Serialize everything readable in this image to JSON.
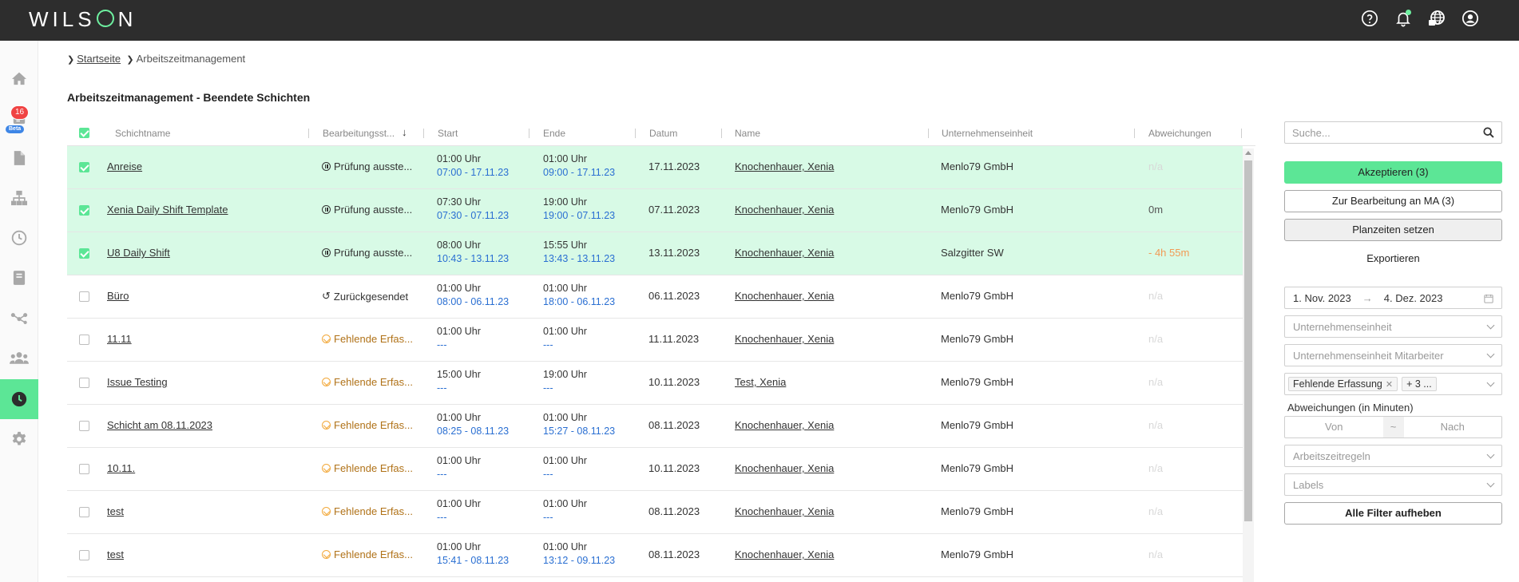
{
  "app": {
    "logo": "WILSON",
    "nav_badge": "16",
    "beta_label": "Beta"
  },
  "breadcrumb": {
    "home": "Startseite",
    "current": "Arbeitszeitmanagement"
  },
  "page_title": "Arbeitszeitmanagement - Beendete Schichten",
  "table": {
    "columns": [
      "Schichtname",
      "Bearbeitungsst...",
      "Start",
      "Ende",
      "Datum",
      "Name",
      "Unternehmenseinheit",
      "Abweichungen"
    ],
    "rows": [
      {
        "shift": "Anreise",
        "status": "Prüfung ausste...",
        "status_type": "pause",
        "start_plan": "01:00 Uhr",
        "start_actual": "07:00 - 17.11.23",
        "end_plan": "01:00 Uhr",
        "end_actual": "09:00 - 17.11.23",
        "date": "17.11.2023",
        "name": "Knochenhauer, Xenia",
        "unit": "Menlo79 GmbH",
        "deviation": "n/a",
        "deviation_type": "na",
        "selected": true
      },
      {
        "shift": "Xenia Daily Shift Template",
        "status": "Prüfung ausste...",
        "status_type": "pause",
        "start_plan": "07:30 Uhr",
        "start_actual": "07:30 - 07.11.23",
        "end_plan": "19:00 Uhr",
        "end_actual": "19:00 - 07.11.23",
        "date": "07.11.2023",
        "name": "Knochenhauer, Xenia",
        "unit": "Menlo79 GmbH",
        "deviation": "0m",
        "deviation_type": "pos",
        "selected": true
      },
      {
        "shift": "U8 Daily Shift",
        "status": "Prüfung ausste...",
        "status_type": "pause",
        "start_plan": "08:00 Uhr",
        "start_actual": "10:43 - 13.11.23",
        "end_plan": "15:55 Uhr",
        "end_actual": "13:43 - 13.11.23",
        "date": "13.11.2023",
        "name": "Knochenhauer, Xenia",
        "unit": "Salzgitter SW",
        "deviation": "- 4h 55m",
        "deviation_type": "neg",
        "selected": true
      },
      {
        "shift": "Büro",
        "status": "Zurückgesendet",
        "status_type": "back",
        "start_plan": "01:00 Uhr",
        "start_actual": "08:00 - 06.11.23",
        "end_plan": "01:00 Uhr",
        "end_actual": "18:00 - 06.11.23",
        "date": "06.11.2023",
        "name": "Knochenhauer, Xenia",
        "unit": "Menlo79 GmbH",
        "deviation": "n/a",
        "deviation_type": "na",
        "selected": false
      },
      {
        "shift": "11.11",
        "status": "Fehlende Erfas...",
        "status_type": "warn",
        "start_plan": "01:00 Uhr",
        "start_actual": "---",
        "end_plan": "01:00 Uhr",
        "end_actual": "---",
        "date": "11.11.2023",
        "name": "Knochenhauer, Xenia",
        "unit": "Menlo79 GmbH",
        "deviation": "n/a",
        "deviation_type": "na",
        "selected": false
      },
      {
        "shift": "Issue Testing",
        "status": "Fehlende Erfas...",
        "status_type": "warn",
        "start_plan": "15:00 Uhr",
        "start_actual": "---",
        "end_plan": "19:00 Uhr",
        "end_actual": "---",
        "date": "10.11.2023",
        "name": "Test, Xenia",
        "unit": "Menlo79 GmbH",
        "deviation": "n/a",
        "deviation_type": "na",
        "selected": false
      },
      {
        "shift": "Schicht am 08.11.2023",
        "status": "Fehlende Erfas...",
        "status_type": "warn",
        "start_plan": "01:00 Uhr",
        "start_actual": "08:25 - 08.11.23",
        "end_plan": "01:00 Uhr",
        "end_actual": "15:27 - 08.11.23",
        "date": "08.11.2023",
        "name": "Knochenhauer, Xenia",
        "unit": "Menlo79 GmbH",
        "deviation": "n/a",
        "deviation_type": "na",
        "selected": false
      },
      {
        "shift": "10.11.",
        "status": "Fehlende Erfas...",
        "status_type": "warn",
        "start_plan": "01:00 Uhr",
        "start_actual": "---",
        "end_plan": "01:00 Uhr",
        "end_actual": "---",
        "date": "10.11.2023",
        "name": "Knochenhauer, Xenia",
        "unit": "Menlo79 GmbH",
        "deviation": "n/a",
        "deviation_type": "na",
        "selected": false
      },
      {
        "shift": "test",
        "status": "Fehlende Erfas...",
        "status_type": "warn",
        "start_plan": "01:00 Uhr",
        "start_actual": "---",
        "end_plan": "01:00 Uhr",
        "end_actual": "---",
        "date": "08.11.2023",
        "name": "Knochenhauer, Xenia",
        "unit": "Menlo79 GmbH",
        "deviation": "n/a",
        "deviation_type": "na",
        "selected": false
      },
      {
        "shift": "test",
        "status": "Fehlende Erfas...",
        "status_type": "warn",
        "start_plan": "01:00 Uhr",
        "start_actual": "15:41 - 08.11.23",
        "end_plan": "01:00 Uhr",
        "end_actual": "13:12 - 09.11.23",
        "date": "08.11.2023",
        "name": "Knochenhauer, Xenia",
        "unit": "Menlo79 GmbH",
        "deviation": "n/a",
        "deviation_type": "na",
        "selected": false
      }
    ]
  },
  "panel": {
    "search_placeholder": "Suche...",
    "accept_label": "Akzeptieren (3)",
    "to_employee_label": "Zur Bearbeitung an MA (3)",
    "set_plan_label": "Planzeiten setzen",
    "export_label": "Exportieren",
    "date_from": "1. Nov. 2023",
    "date_arrow": "→",
    "date_to": "4. Dez. 2023",
    "unit_placeholder": "Unternehmenseinheit",
    "unit_employee_placeholder": "Unternehmenseinheit Mitarbeiter",
    "status_tag": "Fehlende Erfassung",
    "status_more": "+ 3 ...",
    "deviation_label": "Abweichungen (in Minuten)",
    "from_placeholder": "Von",
    "range_sep": "~",
    "to_placeholder": "Nach",
    "rules_placeholder": "Arbeitszeitregeln",
    "labels_placeholder": "Labels",
    "clear_filters_label": "Alle Filter aufheben"
  },
  "colors": {
    "accent": "#5ce696",
    "topbar": "#2d2d2d",
    "selected_row": "#d8fae6",
    "link_time": "#2a6fd2",
    "warn": "#f2a93b"
  }
}
